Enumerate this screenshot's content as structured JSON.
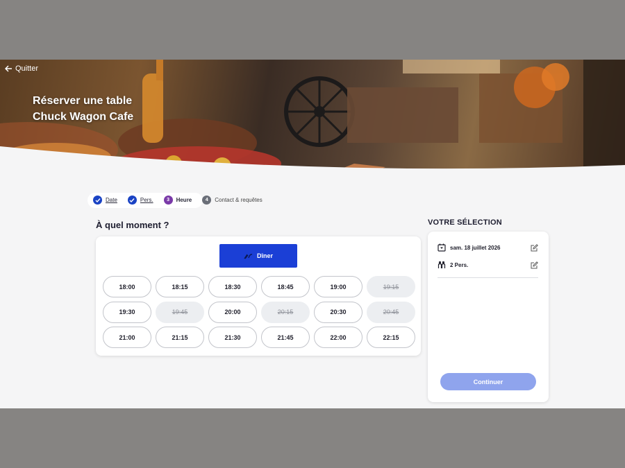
{
  "header": {
    "quit_label": "Quitter",
    "title_line1": "Réserver une table",
    "title_line2": "Chuck Wagon Cafe"
  },
  "stepper": {
    "steps": [
      {
        "label": "Date",
        "state": "done",
        "marker": "check"
      },
      {
        "label": "Pers.",
        "state": "done",
        "marker": "check"
      },
      {
        "label": "Heure",
        "state": "active",
        "marker": "3"
      },
      {
        "label": "Contact & requêtes",
        "state": "todo",
        "marker": "4"
      }
    ]
  },
  "main": {
    "question": "À quel moment ?",
    "meal_button": {
      "label": "Dîner",
      "icon": "meal-icon"
    },
    "time_slots": [
      {
        "time": "18:00",
        "available": true
      },
      {
        "time": "18:15",
        "available": true
      },
      {
        "time": "18:30",
        "available": true
      },
      {
        "time": "18:45",
        "available": true
      },
      {
        "time": "19:00",
        "available": true
      },
      {
        "time": "19:15",
        "available": false
      },
      {
        "time": "19:30",
        "available": true
      },
      {
        "time": "19:45",
        "available": false
      },
      {
        "time": "20:00",
        "available": true
      },
      {
        "time": "20:15",
        "available": false
      },
      {
        "time": "20:30",
        "available": true
      },
      {
        "time": "20:45",
        "available": false
      },
      {
        "time": "21:00",
        "available": true
      },
      {
        "time": "21:15",
        "available": true
      },
      {
        "time": "21:30",
        "available": true
      },
      {
        "time": "21:45",
        "available": true
      },
      {
        "time": "22:00",
        "available": true
      },
      {
        "time": "22:15",
        "available": true
      }
    ]
  },
  "selection": {
    "title": "VOTRE SÉLECTION",
    "date": "sam. 18 juillet 2026",
    "persons": "2 Pers.",
    "continue_label": "Continuer"
  },
  "colors": {
    "accent": "#1b3fd6",
    "step_done": "#1a43c4",
    "step_active": "#7a3aa8",
    "continue_disabled": "#8fa4ed"
  }
}
